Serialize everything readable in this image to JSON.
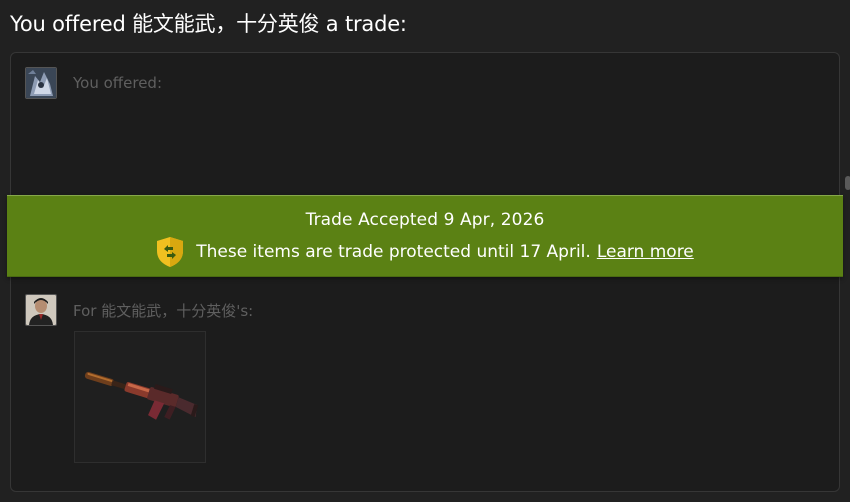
{
  "header": {
    "title": "You offered 能文能武，十分英俊 a trade:"
  },
  "offer": {
    "you_offered_label": "You offered:",
    "for_label": "For 能文能武，十分英俊's:",
    "for_items": [
      {
        "icon": "rifle-with-suppressor-icon"
      }
    ]
  },
  "status_banner": {
    "title": "Trade Accepted 9 Apr, 2026",
    "detail_text": "These items are trade protected until 17 April.",
    "learn_more_link": "Learn more",
    "icon": "shield-trade-protected-icon"
  },
  "colors": {
    "background": "#212121",
    "panel": "#1c1c1c",
    "banner_green": "#5b8114",
    "shield_yellow": "#f0c020",
    "muted_text": "#5f5f5f"
  }
}
